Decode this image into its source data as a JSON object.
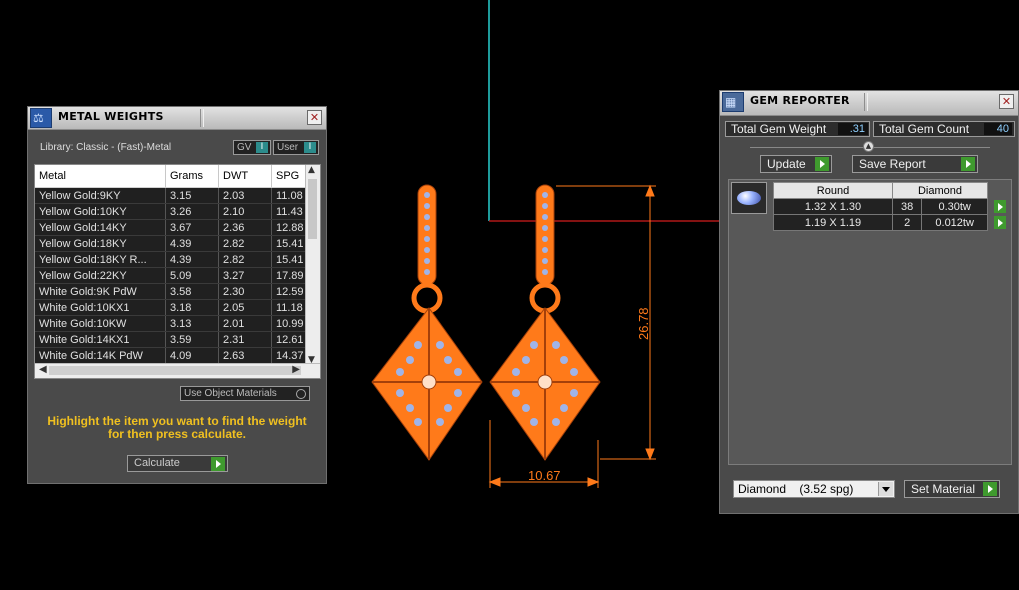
{
  "metal_weights": {
    "title": "METAL WEIGHTS",
    "library": "Library: Classic - (Fast)-Metal",
    "gv_toggle": "GV",
    "user_toggle": "User",
    "toggle_mark": "I",
    "columns": [
      "Metal",
      "Grams",
      "DWT",
      "SPG"
    ],
    "rows": [
      [
        "Yellow Gold:9KY",
        "3.15",
        "2.03",
        "11.08"
      ],
      [
        "Yellow Gold:10KY",
        "3.26",
        "2.10",
        "11.43"
      ],
      [
        "Yellow Gold:14KY",
        "3.67",
        "2.36",
        "12.88"
      ],
      [
        "Yellow Gold:18KY",
        "4.39",
        "2.82",
        "15.41"
      ],
      [
        "Yellow Gold:18KY R...",
        "4.39",
        "2.82",
        "15.41"
      ],
      [
        "Yellow Gold:22KY",
        "5.09",
        "3.27",
        "17.89"
      ],
      [
        "White Gold:9K PdW",
        "3.58",
        "2.30",
        "12.59"
      ],
      [
        "White Gold:10KX1",
        "3.18",
        "2.05",
        "11.18"
      ],
      [
        "White Gold:10KW",
        "3.13",
        "2.01",
        "10.99"
      ],
      [
        "White Gold:14KX1",
        "3.59",
        "2.31",
        "12.61"
      ],
      [
        "White Gold:14K PdW",
        "4.09",
        "2.63",
        "14.37"
      ]
    ],
    "use_object_materials": "Use Object Materials",
    "instruction": "Highlight the item you want to find the weight for then press calculate.",
    "calculate_label": "Calculate"
  },
  "gem_reporter": {
    "title": "GEM REPORTER",
    "total_weight_label": "Total Gem Weight",
    "total_weight_value": ".31",
    "total_count_label": "Total Gem Count",
    "total_count_value": "40",
    "update_label": "Update",
    "save_report_label": "Save Report",
    "headers": [
      "Round",
      "Diamond"
    ],
    "gems": [
      {
        "size": "1.32 X 1.30",
        "count": "38",
        "weight": "0.30tw"
      },
      {
        "size": "1.19 X 1.19",
        "count": "2",
        "weight": "0.012tw"
      }
    ],
    "material_select": "Diamond    (3.52 spg)",
    "set_material_label": "Set Material"
  },
  "viewport": {
    "dim_height": "26.78",
    "dim_width": "10.67",
    "accent_color": "#ff7a1a",
    "gem_color": "#a0b4e8"
  }
}
